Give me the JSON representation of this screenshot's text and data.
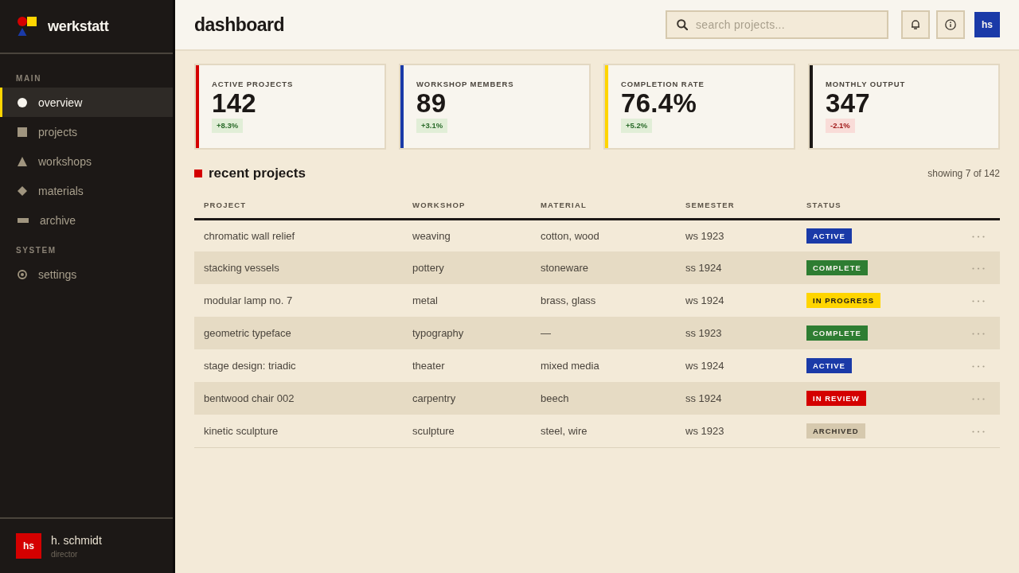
{
  "sidebar": {
    "brand": "werkstatt",
    "sections": [
      {
        "label": "MAIN",
        "items": [
          {
            "label": "overview",
            "selected": true
          },
          {
            "label": "projects",
            "selected": false
          },
          {
            "label": "workshops",
            "selected": false
          },
          {
            "label": "materials",
            "selected": false
          },
          {
            "label": "archive",
            "selected": false
          }
        ]
      },
      {
        "label": "SYSTEM",
        "items": [
          {
            "label": "settings",
            "selected": false
          }
        ]
      }
    ],
    "user": {
      "initials": "hs",
      "name": "h. schmidt",
      "role": "director"
    }
  },
  "header": {
    "title": "dashboard",
    "search": {
      "placeholder": "search projects..."
    },
    "avatar": "hs"
  },
  "stats": [
    {
      "label": "ACTIVE PROJECTS",
      "value": "142",
      "color": "#d40000",
      "change": "+8.3%",
      "negative": false
    },
    {
      "label": "WORKSHOP MEMBERS",
      "value": "89",
      "color": "#1a3aa8",
      "change": "+3.1%",
      "negative": false
    },
    {
      "label": "COMPLETION RATE",
      "value": "76.4%",
      "color": "#ffd500",
      "change": "+5.2%",
      "negative": false
    },
    {
      "label": "MONTHLY OUTPUT",
      "value": "347",
      "color": "#1c1816",
      "change": "-2.1%",
      "negative": true
    }
  ],
  "projects": {
    "title": "recent projects",
    "count": "showing 7 of 142",
    "columns": [
      "PROJECT",
      "WORKSHOP",
      "MATERIAL",
      "SEMESTER",
      "STATUS"
    ],
    "rows": [
      {
        "project": "chromatic wall relief",
        "workshop": "weaving",
        "material": "cotton, wood",
        "semester": "ws 1923",
        "status": {
          "label": "ACTIVE",
          "kind": "active"
        }
      },
      {
        "project": "stacking vessels",
        "workshop": "pottery",
        "material": "stoneware",
        "semester": "ss 1924",
        "status": {
          "label": "COMPLETE",
          "kind": "complete"
        }
      },
      {
        "project": "modular lamp no. 7",
        "workshop": "metal",
        "material": "brass, glass",
        "semester": "ws 1924",
        "status": {
          "label": "IN PROGRESS",
          "kind": "progress"
        }
      },
      {
        "project": "geometric typeface",
        "workshop": "typography",
        "material": "—",
        "semester": "ss 1923",
        "status": {
          "label": "COMPLETE",
          "kind": "complete"
        }
      },
      {
        "project": "stage design: triadic",
        "workshop": "theater",
        "material": "mixed media",
        "semester": "ws 1924",
        "status": {
          "label": "ACTIVE",
          "kind": "active"
        }
      },
      {
        "project": "bentwood chair 002",
        "workshop": "carpentry",
        "material": "beech",
        "semester": "ss 1924",
        "status": {
          "label": "IN REVIEW",
          "kind": "review"
        }
      },
      {
        "project": "kinetic sculpture",
        "workshop": "sculpture",
        "material": "steel, wire",
        "semester": "ws 1923",
        "status": {
          "label": "ARCHIVED",
          "kind": "archived"
        }
      }
    ]
  }
}
